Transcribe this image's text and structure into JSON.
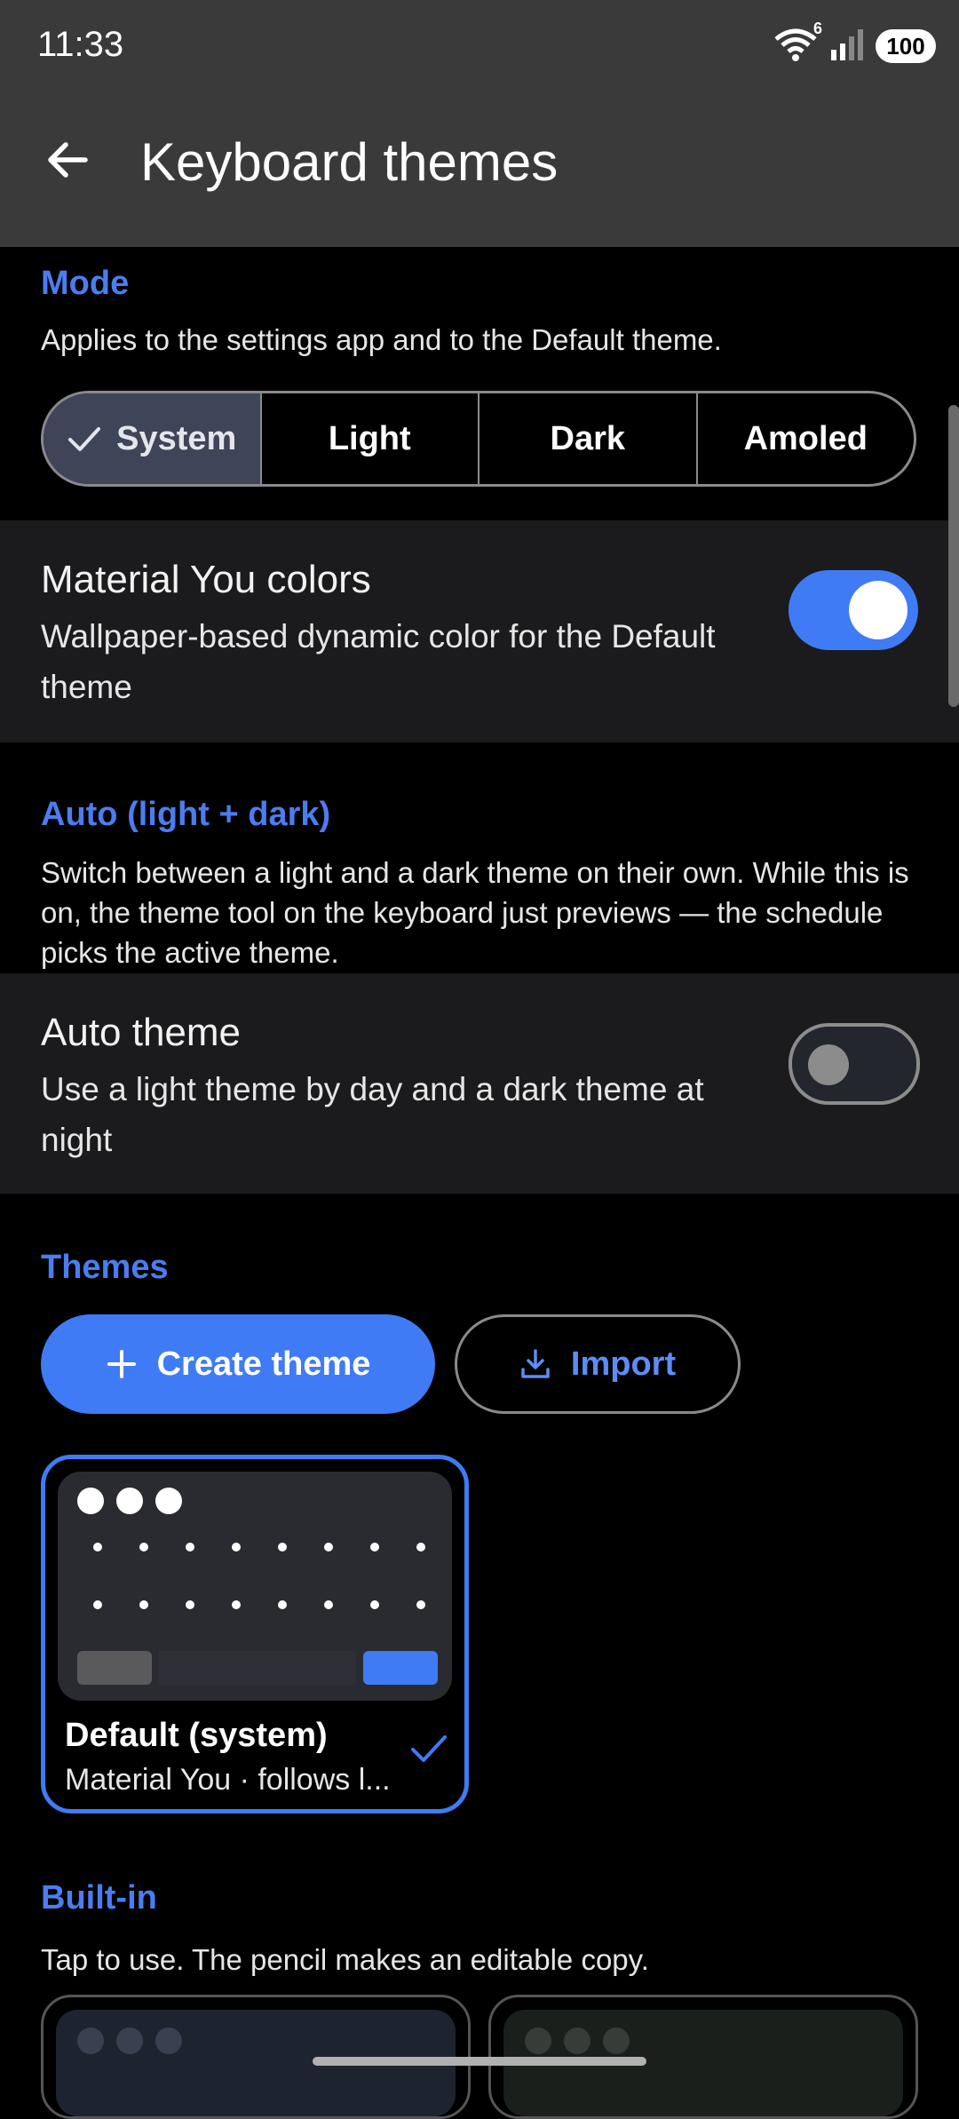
{
  "status_bar": {
    "time": "11:33",
    "battery": "100",
    "wifi_badge": "6"
  },
  "app_bar": {
    "title": "Keyboard themes"
  },
  "mode": {
    "title": "Mode",
    "description": "Applies to the settings app and to the Default theme.",
    "options": [
      "System",
      "Light",
      "Dark",
      "Amoled"
    ],
    "selected": "System"
  },
  "material_you": {
    "title": "Material You colors",
    "subtitle": "Wallpaper-based dynamic color for the Default theme",
    "enabled": true
  },
  "auto": {
    "title": "Auto (light + dark)",
    "description": "Switch between a light and a dark theme on their own. While this is on, the theme tool on the keyboard just previews — the schedule picks the active theme."
  },
  "auto_theme": {
    "title": "Auto theme",
    "subtitle": "Use a light theme by day and a dark theme at night",
    "enabled": false
  },
  "themes": {
    "title": "Themes",
    "create_label": "Create theme",
    "import_label": "Import",
    "cards": [
      {
        "name": "Default (system)",
        "subtitle": "Material You · follows l...",
        "selected": true
      }
    ]
  },
  "builtin": {
    "title": "Built-in",
    "description": "Tap to use. The pencil makes an editable copy."
  },
  "colors": {
    "accent": "#3f7bf4",
    "section": "#4b7df0",
    "card": "#1b1b1d"
  }
}
